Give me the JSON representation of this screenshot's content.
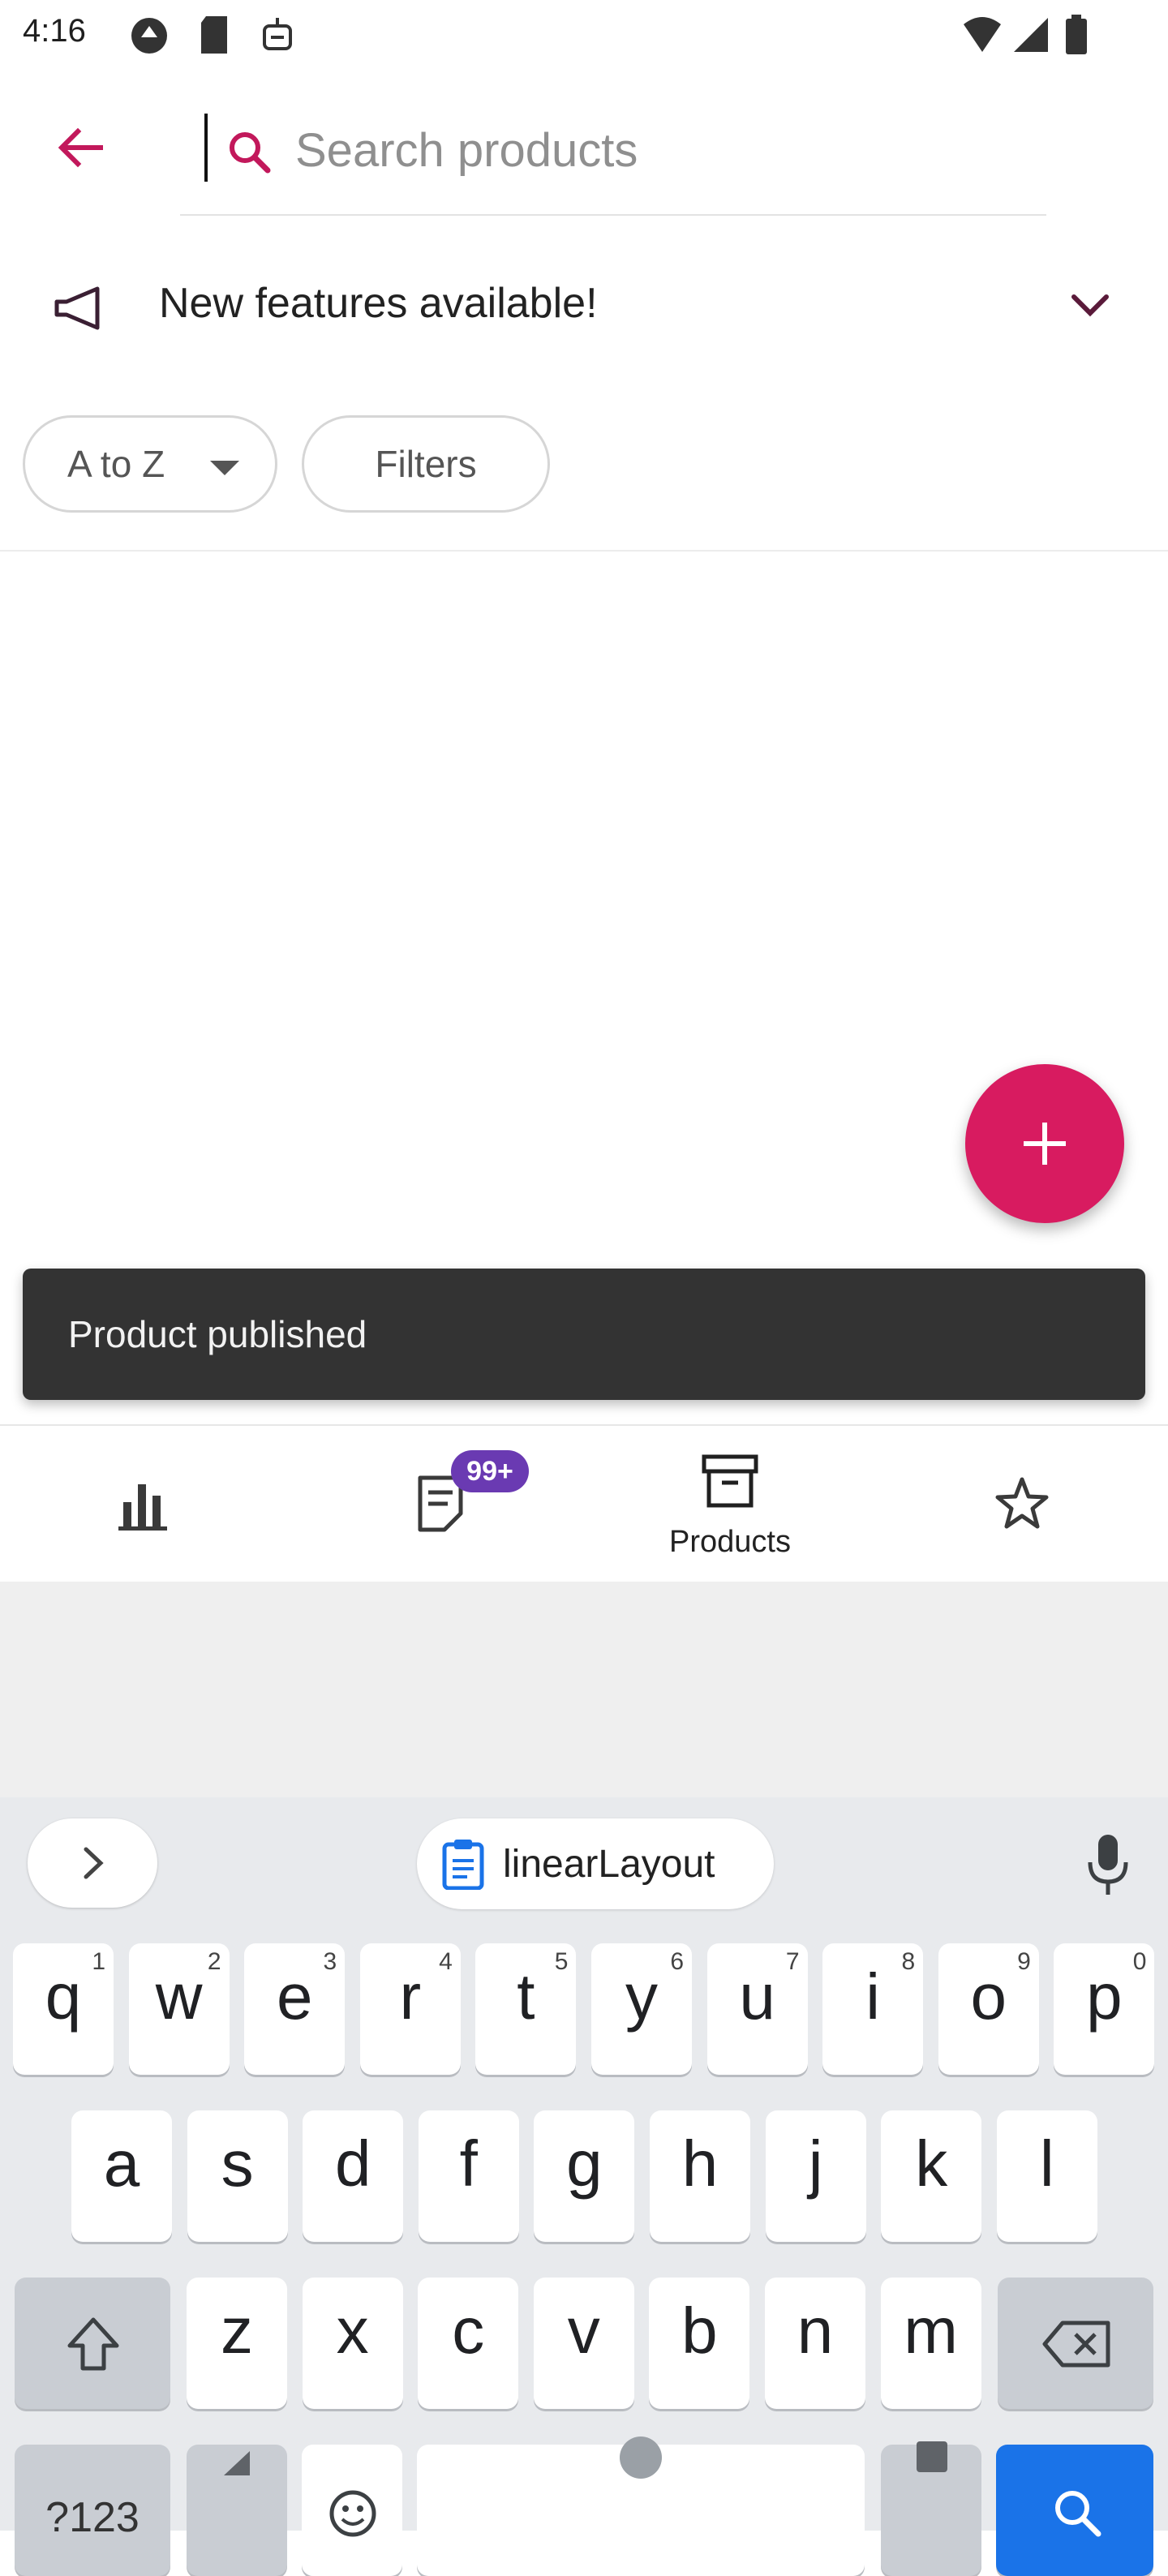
{
  "status_bar": {
    "time": "4:16"
  },
  "search": {
    "placeholder": "Search products",
    "value": ""
  },
  "banner": {
    "text": "New features available!"
  },
  "chips": {
    "sort_label": "A to Z",
    "filters_label": "Filters"
  },
  "snackbar": {
    "text": "Product published"
  },
  "bottom_nav": {
    "items": [
      {
        "name": "Dashboard",
        "label": ""
      },
      {
        "name": "Orders",
        "label": "",
        "badge": "99+"
      },
      {
        "name": "Products",
        "label": "Products"
      },
      {
        "name": "Reviews",
        "label": ""
      }
    ]
  },
  "keyboard": {
    "clipboard_chip": "linearLayout",
    "row1": [
      {
        "key": "q",
        "sub": "1"
      },
      {
        "key": "w",
        "sub": "2"
      },
      {
        "key": "e",
        "sub": "3"
      },
      {
        "key": "r",
        "sub": "4"
      },
      {
        "key": "t",
        "sub": "5"
      },
      {
        "key": "y",
        "sub": "6"
      },
      {
        "key": "u",
        "sub": "7"
      },
      {
        "key": "i",
        "sub": "8"
      },
      {
        "key": "o",
        "sub": "9"
      },
      {
        "key": "p",
        "sub": "0"
      }
    ],
    "row2": [
      "a",
      "s",
      "d",
      "f",
      "g",
      "h",
      "j",
      "k",
      "l"
    ],
    "row3": [
      "z",
      "x",
      "c",
      "v",
      "b",
      "n",
      "m"
    ],
    "symbols_label": "?123"
  },
  "colors": {
    "accent": "#d81b60",
    "badge": "#6a3ab2",
    "snackbar_bg": "#333333",
    "keyboard_bg": "#e8eaed",
    "search_key": "#1a73e8"
  }
}
